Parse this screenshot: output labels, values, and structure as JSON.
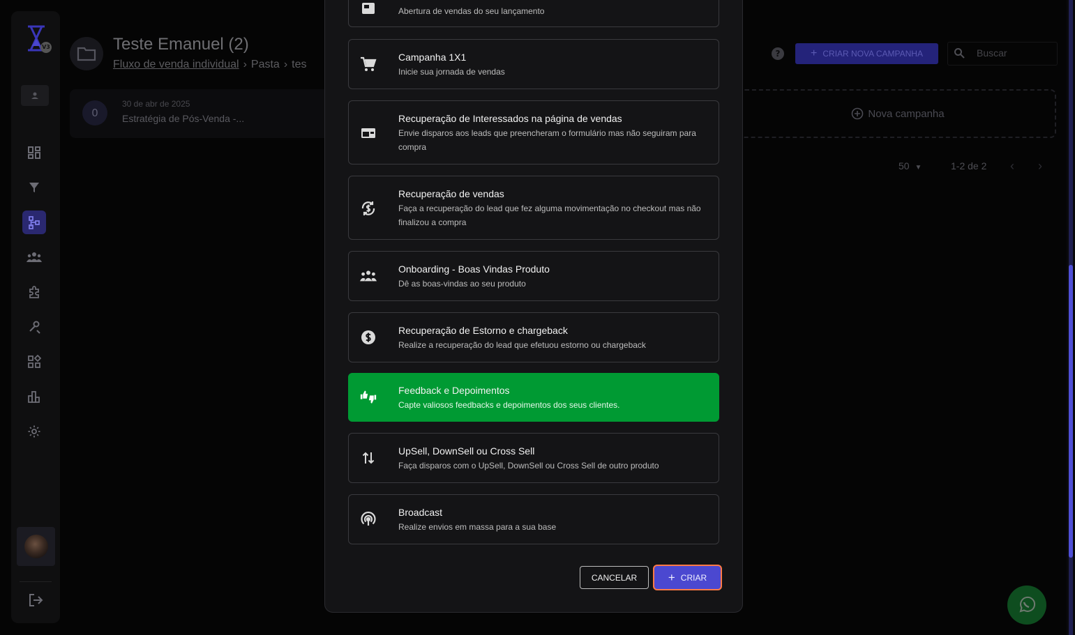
{
  "header": {
    "title": "Teste Emanuel (2)",
    "breadcrumb": [
      "Fluxo de venda individual",
      "Pasta",
      "tes"
    ],
    "new_campaign_button": "CRIAR NOVA CAMPANHA",
    "search_placeholder": "Buscar"
  },
  "sidebar": {
    "logo_badge": "V3",
    "items": [
      "dashboard",
      "funnel",
      "flows",
      "audience",
      "integrations",
      "tools",
      "widgets",
      "reports",
      "settings"
    ],
    "active_item": "flows"
  },
  "campaign_card": {
    "circle_value": "0",
    "date": "30 de abr de 2025",
    "name": "Estratégia de Pós-Venda -..."
  },
  "add_campaign_label": "Nova campanha",
  "pagination": {
    "per_page": "50",
    "range": "1-2 de 2"
  },
  "modal": {
    "options": [
      {
        "title": "",
        "desc": "Abertura de vendas do seu lançamento",
        "icon": "newspaper-icon"
      },
      {
        "title": "Campanha 1X1",
        "desc": "Inicie sua jornada de vendas",
        "icon": "cart-icon"
      },
      {
        "title": "Recuperação de Interessados na página de vendas",
        "desc": "Envie disparos aos leads que preencheram o formulário mas não seguiram para compra",
        "icon": "web-form-icon"
      },
      {
        "title": "Recuperação de vendas",
        "desc": "Faça a recuperação do lead que fez alguma movimentação no checkout mas não finalizou a compra",
        "icon": "currency-sync-icon"
      },
      {
        "title": "Onboarding - Boas Vindas Produto",
        "desc": "Dê as boas-vindas ao seu produto",
        "icon": "group-icon"
      },
      {
        "title": "Recuperação de Estorno e chargeback",
        "desc": "Realize a recuperação do lead que efetuou estorno ou chargeback",
        "icon": "dollar-circle-icon"
      },
      {
        "title": "Feedback e Depoimentos",
        "desc": "Capte valiosos feedbacks e depoimentos dos seus clientes.",
        "icon": "thumbs-up-down-icon",
        "selected": true
      },
      {
        "title": "UpSell, DownSell ou Cross Sell",
        "desc": "Faça disparos com o UpSell, DownSell ou Cross Sell de outro produto",
        "icon": "swap-vert-icon"
      },
      {
        "title": "Broadcast",
        "desc": "Realize envios em massa para a sua base",
        "icon": "broadcast-icon"
      }
    ],
    "cancel_label": "CANCELAR",
    "create_label": "CRIAR"
  },
  "colors": {
    "selected": "#009a33",
    "primary": "#4b48d0",
    "focus_ring": "#ff7a45"
  }
}
